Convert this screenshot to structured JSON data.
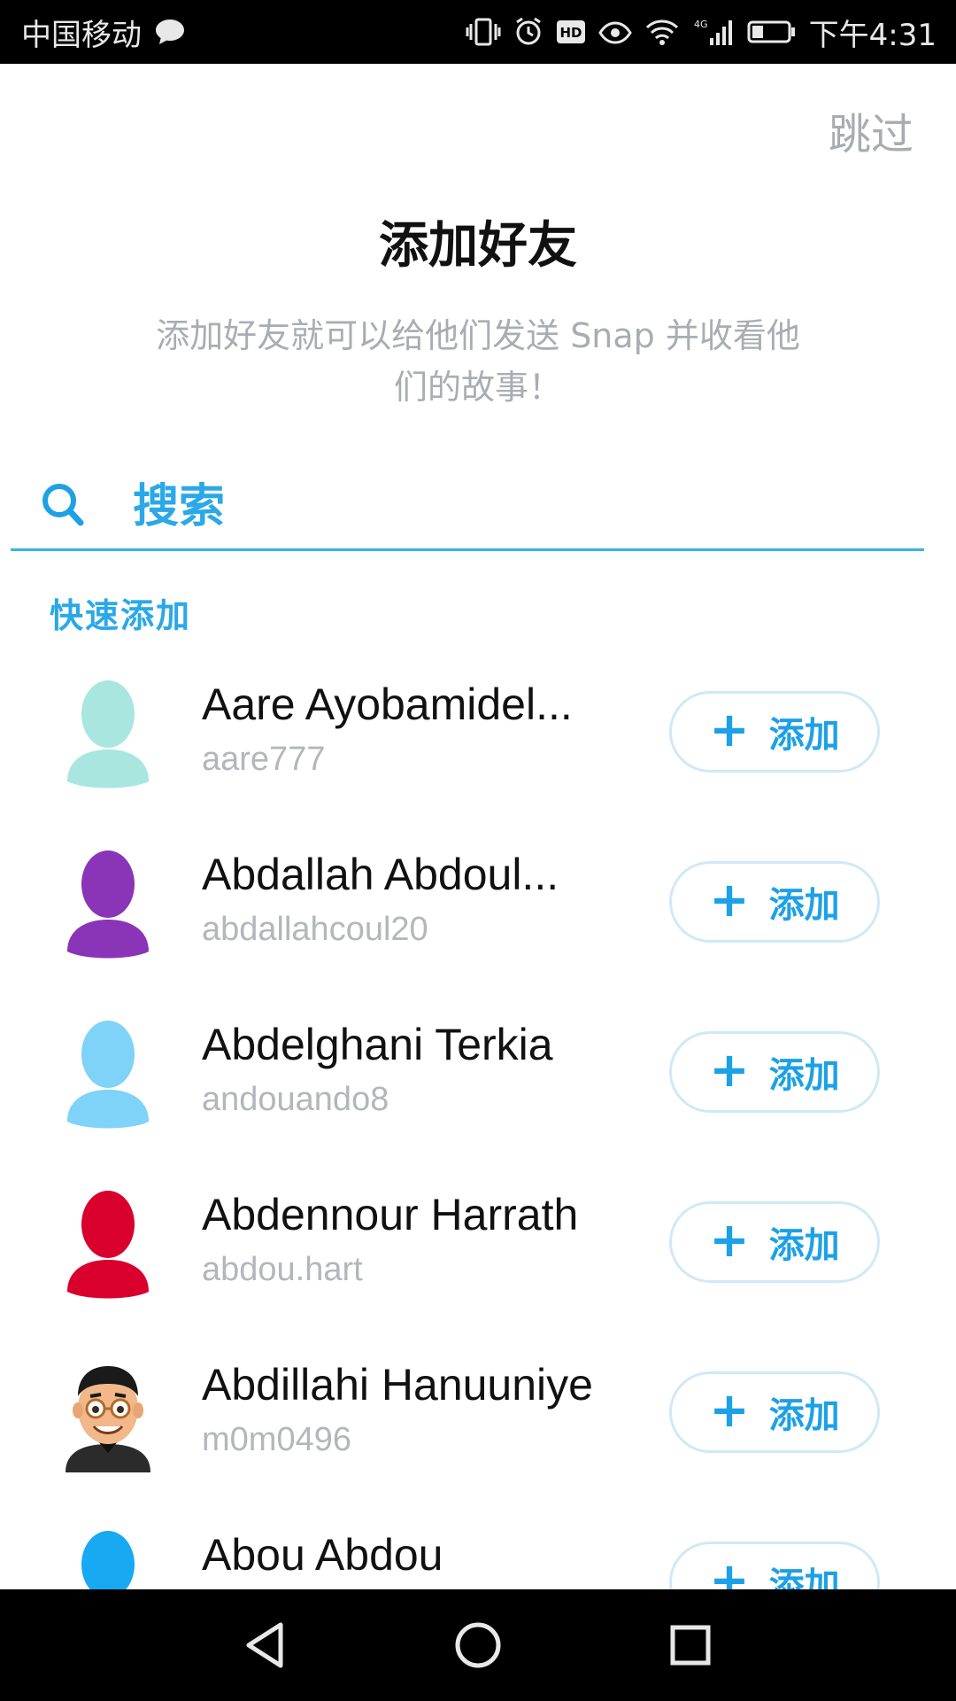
{
  "status_bar": {
    "carrier": "中国移动",
    "network": "4G",
    "time": "下午4:31",
    "icons": [
      "message-icon",
      "vibrate-icon",
      "alarm-icon",
      "hd-icon",
      "eye-comfort-icon",
      "wifi-icon",
      "signal-icon",
      "battery-icon"
    ]
  },
  "header": {
    "skip_label": "跳过",
    "title": "添加好友",
    "subtitle": "添加好友就可以给他们发送 Snap 并收看他们的故事！"
  },
  "search": {
    "placeholder": "搜索",
    "value": ""
  },
  "quick_add": {
    "section_label": "快速添加",
    "add_label": "添加",
    "add_symbol": "+",
    "friends": [
      {
        "name": "Aare Ayobamidel...",
        "username": "aare777",
        "avatar": "silhouette",
        "avatar_color": "#a8e6df"
      },
      {
        "name": "Abdallah Abdoul...",
        "username": "abdallahcoul20",
        "avatar": "silhouette",
        "avatar_color": "#8a34b8"
      },
      {
        "name": "Abdelghani Terkia",
        "username": "andouando8",
        "avatar": "silhouette",
        "avatar_color": "#7fd2f8"
      },
      {
        "name": "Abdennour Harrath",
        "username": "abdou.hart",
        "avatar": "silhouette",
        "avatar_color": "#d9002e"
      },
      {
        "name": "Abdillahi Hanuuniye",
        "username": "m0m0496",
        "avatar": "bitmoji",
        "avatar_color": "#f2b88a"
      },
      {
        "name": "Abou Abdou",
        "username": "",
        "avatar": "silhouette",
        "avatar_color": "#17a9f2"
      }
    ]
  },
  "nav_bar": {
    "buttons": [
      "back-icon",
      "home-icon",
      "recents-icon"
    ]
  }
}
